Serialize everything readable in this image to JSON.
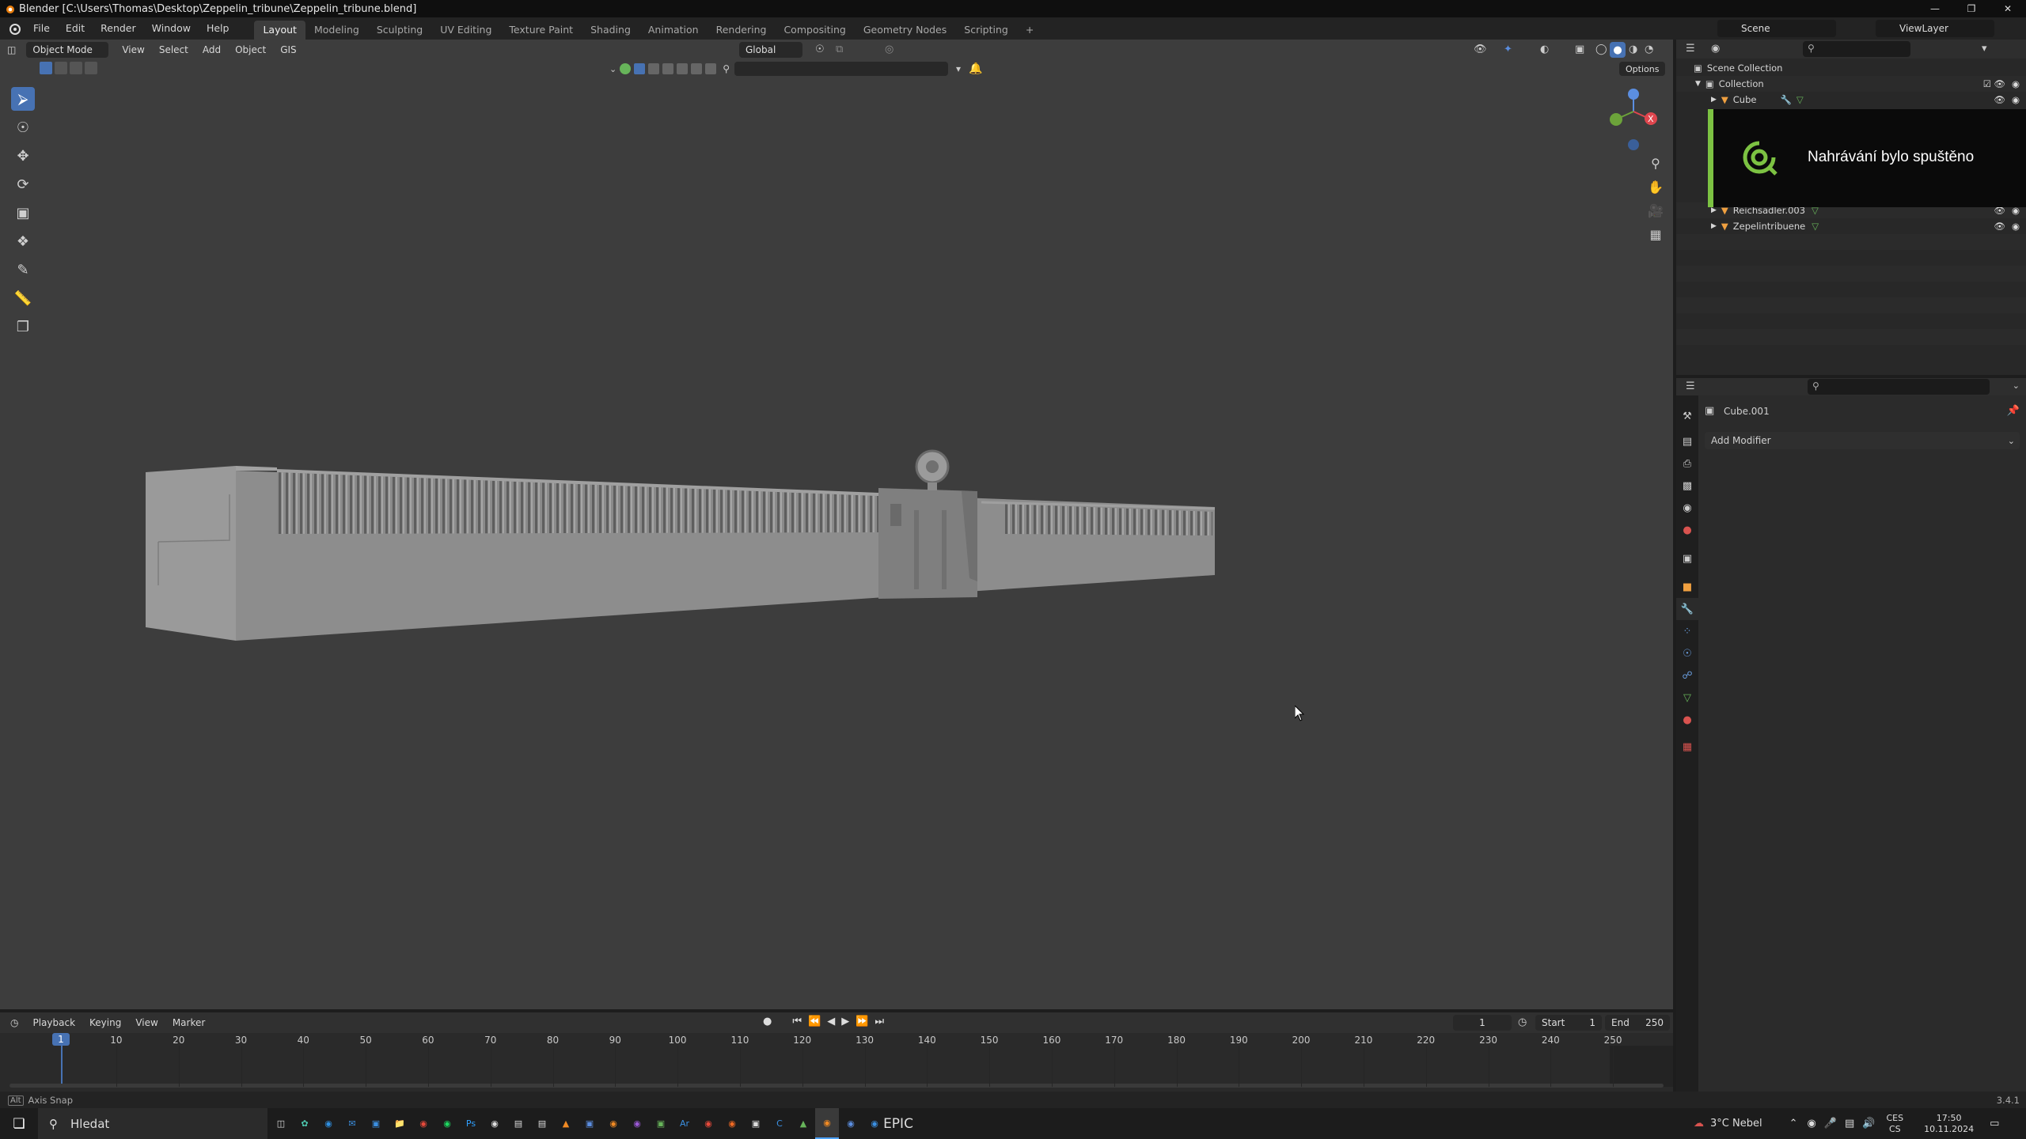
{
  "window": {
    "title": "Blender [C:\\Users\\Thomas\\Desktop\\Zeppelin_tribune\\Zeppelin_tribune.blend]"
  },
  "menu": [
    "File",
    "Edit",
    "Render",
    "Window",
    "Help"
  ],
  "workspaces": [
    "Layout",
    "Modeling",
    "Sculpting",
    "UV Editing",
    "Texture Paint",
    "Shading",
    "Animation",
    "Rendering",
    "Compositing",
    "Geometry Nodes",
    "Scripting"
  ],
  "active_workspace": "Layout",
  "scene": {
    "name": "Scene",
    "view_layer": "ViewLayer"
  },
  "viewport_header": {
    "mode": "Object Mode",
    "menus": [
      "View",
      "Select",
      "Add",
      "Object",
      "GIS"
    ],
    "orientation": "Global",
    "options_label": "Options"
  },
  "outliner": {
    "scene_collection": "Scene Collection",
    "collection": "Collection",
    "items": [
      "Cube",
      "Reichsadler.003",
      "Zepelintribuene"
    ]
  },
  "notification": {
    "text": "Nahrávání bylo spuštěno"
  },
  "properties": {
    "object_name": "Cube.001",
    "add_modifier_label": "Add Modifier"
  },
  "timeline": {
    "menus": [
      "Playback",
      "Keying",
      "View",
      "Marker"
    ],
    "current_frame": "1",
    "start_label": "Start",
    "start_value": "1",
    "end_label": "End",
    "end_value": "250",
    "ticks": [
      "10",
      "20",
      "30",
      "40",
      "50",
      "60",
      "70",
      "80",
      "90",
      "100",
      "110",
      "120",
      "130",
      "140",
      "150",
      "160",
      "170",
      "180",
      "190",
      "200",
      "210",
      "220",
      "230",
      "240",
      "250"
    ],
    "playhead_label": "1"
  },
  "status": {
    "left": "Axis Snap",
    "version": "3.4.1"
  },
  "taskbar": {
    "search_placeholder": "Hledat",
    "weather": "3°C  Nebel",
    "lang_top": "CES",
    "lang_bottom": "CS",
    "time": "17:50",
    "date": "10.11.2024",
    "icons": [
      "task-view-icon",
      "app-green-icon",
      "edge-icon",
      "mail-icon",
      "store-icon",
      "files-icon",
      "chrome-icon",
      "spotify-icon",
      "photoshop-icon",
      "steam-icon",
      "document-icon",
      "document2-icon",
      "vlc-icon",
      "app-blue-icon",
      "blender-icon",
      "app-purple-icon",
      "app-green2-icon",
      "app-ar-icon",
      "app-red-icon",
      "app-orange-icon",
      "app-dark-icon",
      "app-c-icon",
      "app-green3-icon",
      "blender-active-icon",
      "app-bird-icon",
      "app-d-icon",
      "epic-games-icon"
    ]
  },
  "colors": {
    "accent": "#4772b3",
    "viewport_bg": "#3d3d3d",
    "notification_accent": "#7cc242"
  }
}
